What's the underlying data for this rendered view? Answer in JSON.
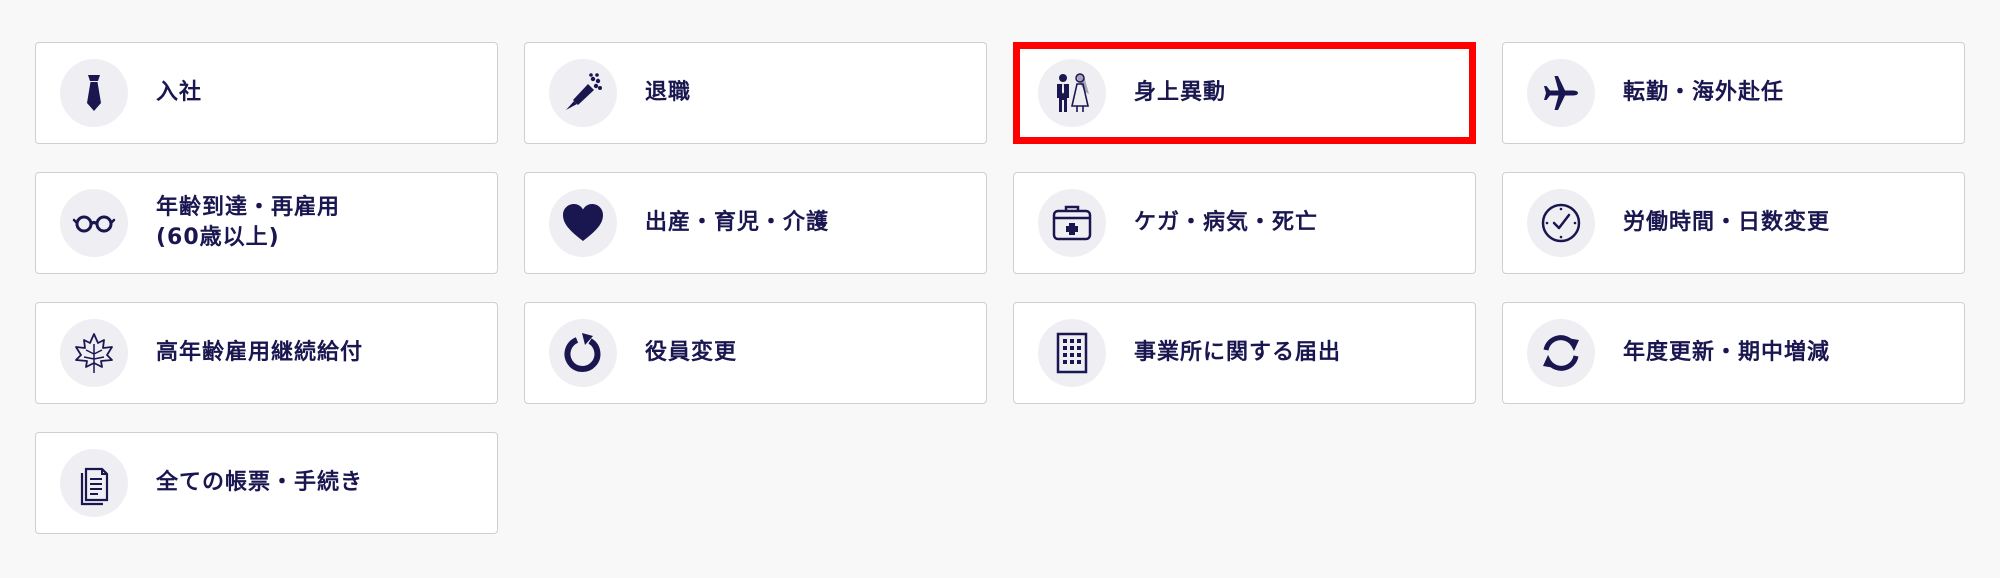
{
  "accent_color": "#1a1650",
  "selected_border_color": "#ff0000",
  "items": [
    {
      "id": "nyusha",
      "label": "入社",
      "icon": "necktie-icon"
    },
    {
      "id": "taishoku",
      "label": "退職",
      "icon": "bouquet-icon"
    },
    {
      "id": "shinjo-ido",
      "label": "身上異動",
      "icon": "couple-icon",
      "selected": true
    },
    {
      "id": "tenkin",
      "label": "転勤・海外赴任",
      "icon": "airplane-icon"
    },
    {
      "id": "nenrei",
      "label": "年齢到達・再雇用\n(60歳以上)",
      "icon": "glasses-icon"
    },
    {
      "id": "shussan",
      "label": "出産・育児・介護",
      "icon": "heart-icon"
    },
    {
      "id": "kega",
      "label": "ケガ・病気・死亡",
      "icon": "medical-kit-icon"
    },
    {
      "id": "rodo-jikan",
      "label": "労働時間・日数変更",
      "icon": "clock-icon"
    },
    {
      "id": "konenrei",
      "label": "高年齢雇用継続給付",
      "icon": "maple-leaf-icon"
    },
    {
      "id": "yakuin",
      "label": "役員変更",
      "icon": "refresh-icon"
    },
    {
      "id": "jigyosho",
      "label": "事業所に関する届出",
      "icon": "building-icon"
    },
    {
      "id": "nendo",
      "label": "年度更新・期中増減",
      "icon": "sync-icon"
    },
    {
      "id": "subete",
      "label": "全ての帳票・手続き",
      "icon": "documents-icon"
    }
  ]
}
